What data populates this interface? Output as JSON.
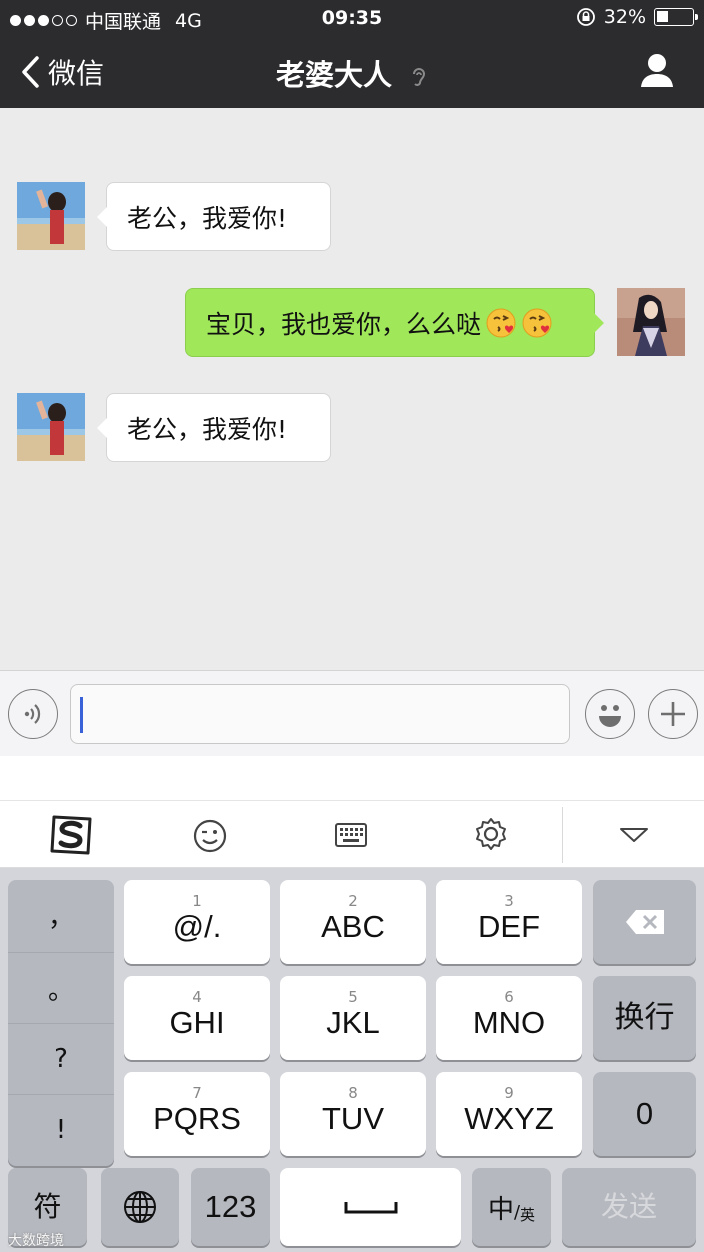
{
  "status_bar": {
    "carrier": "中国联通",
    "network": "4G",
    "time": "09:35",
    "battery_percent": "32%",
    "battery_level": 0.32
  },
  "nav": {
    "back_label": "微信",
    "title": "老婆大人"
  },
  "messages": [
    {
      "direction": "incoming",
      "text": "老公，我爱你!"
    },
    {
      "direction": "outgoing",
      "text": "宝贝，我也爱你，么么哒",
      "emoji": [
        "kiss-heart-emoji",
        "kiss-heart-emoji"
      ]
    },
    {
      "direction": "incoming",
      "text": "老公，我爱你!"
    }
  ],
  "input": {
    "value": "",
    "voice_icon": "voice-icon",
    "emoji_icon": "smiley-icon",
    "more_icon": "plus-icon"
  },
  "ime_toolbar": {
    "icons": [
      "sogou-logo-icon",
      "wink-emoji-icon",
      "keyboard-icon",
      "gear-icon",
      "chevron-down-icon"
    ]
  },
  "keyboard": {
    "punctuation": [
      "，",
      "。",
      "?",
      "!"
    ],
    "keys": [
      {
        "num": "1",
        "label": "@/."
      },
      {
        "num": "2",
        "label": "ABC"
      },
      {
        "num": "3",
        "label": "DEF"
      },
      {
        "num": "4",
        "label": "GHI"
      },
      {
        "num": "5",
        "label": "JKL"
      },
      {
        "num": "6",
        "label": "MNO"
      },
      {
        "num": "7",
        "label": "PQRS"
      },
      {
        "num": "8",
        "label": "TUV"
      },
      {
        "num": "9",
        "label": "WXYZ"
      }
    ],
    "delete_icon": "backspace-icon",
    "newline_label": "换行",
    "zero_label": "0",
    "symbol_label": "符",
    "globe_icon": "globe-icon",
    "numbers_label": "123",
    "lang_label_main": "中",
    "lang_label_sub": "英",
    "send_label": "发送"
  },
  "watermark": "大数跨境"
}
